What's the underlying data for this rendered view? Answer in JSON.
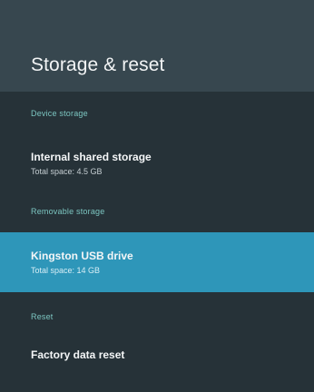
{
  "header": {
    "title": "Storage & reset"
  },
  "sections": [
    {
      "label": "Device storage"
    },
    {
      "label": "Removable storage"
    },
    {
      "label": "Reset"
    }
  ],
  "items": [
    {
      "title": "Internal shared storage",
      "subtitle": "Total space: 4.5 GB"
    },
    {
      "title": "Kingston USB drive",
      "subtitle": "Total space: 14 GB"
    },
    {
      "title": "Factory data reset"
    }
  ],
  "colors": {
    "header_bg": "#37474f",
    "list_bg": "#263238",
    "section_label": "#7cc6c1",
    "selected_bg": "#2e96b9"
  }
}
